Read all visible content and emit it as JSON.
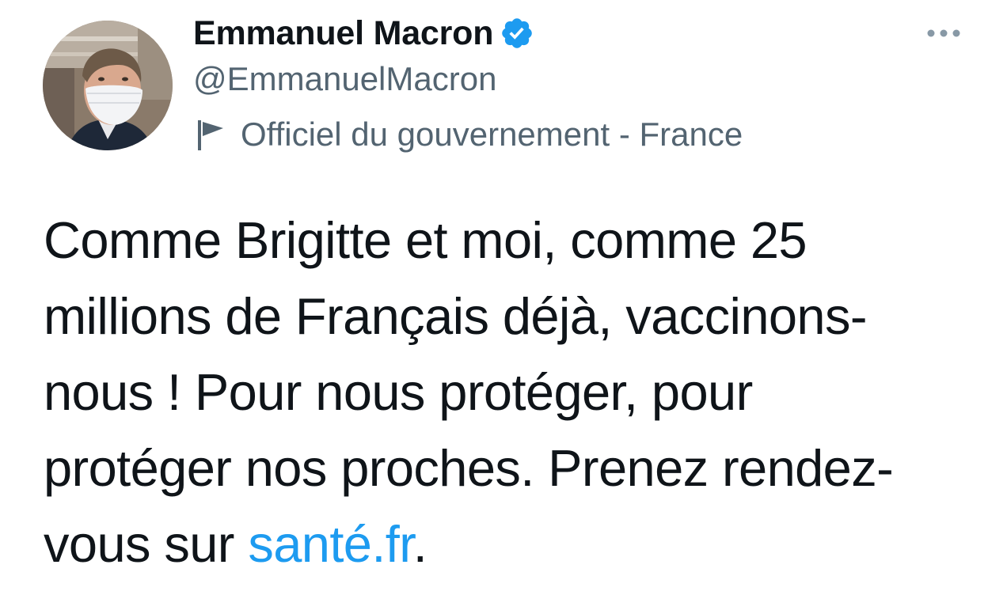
{
  "author": {
    "display_name": "Emmanuel Macron",
    "handle": "@EmmanuelMacron",
    "verified": true,
    "account_label": "Officiel du gouvernement - France",
    "avatar_icon": "profile-photo"
  },
  "tweet": {
    "lines": [
      "Comme Brigitte et moi, comme 25",
      "millions de Français déjà, vaccinons-",
      "nous ! Pour nous protéger, pour",
      "protéger nos proches. Prenez rendez-"
    ],
    "last_line_prefix": "vous sur ",
    "link_text": "santé.fr",
    "last_line_suffix": "."
  },
  "icons": {
    "verified": "verified-badge-icon",
    "label": "flag-icon",
    "more": "more-options-icon"
  },
  "colors": {
    "text": "#0f1419",
    "secondary": "#536471",
    "link": "#1d9bf0",
    "verified": "#1d9bf0"
  }
}
